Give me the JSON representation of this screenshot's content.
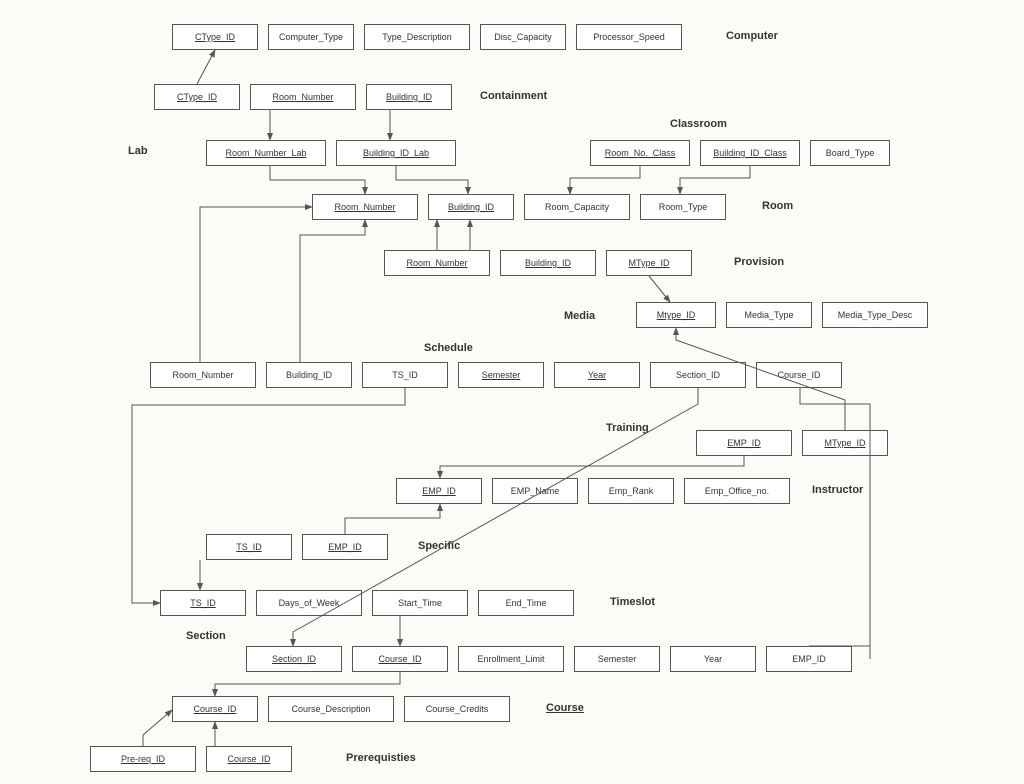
{
  "tables": {
    "computer": {
      "label": "Computer",
      "fields": [
        "CType_ID",
        "Computer_Type",
        "Type_Description",
        "Disc_Capacity",
        "Processor_Speed"
      ],
      "keys": [
        true,
        false,
        false,
        false,
        false
      ]
    },
    "containment": {
      "label": "Containment",
      "fields": [
        "CType_ID",
        "Room_Number",
        "Building_ID"
      ],
      "keys": [
        true,
        true,
        true
      ]
    },
    "lab": {
      "label": "Lab",
      "fields": [
        "Room_Number_Lab",
        "Building_ID_Lab"
      ],
      "keys": [
        true,
        true
      ]
    },
    "classroom": {
      "label": "Classroom",
      "fields": [
        "Room_No._Class",
        "Building_ID_Class",
        "Board_Type"
      ],
      "keys": [
        true,
        true,
        false
      ]
    },
    "room": {
      "label": "Room",
      "fields": [
        "Room_Number",
        "Building_ID",
        "Room_Capacity",
        "Room_Type"
      ],
      "keys": [
        true,
        true,
        false,
        false
      ]
    },
    "provision": {
      "label": "Provision",
      "fields": [
        "Room_Number",
        "Building_ID",
        "MType_ID"
      ],
      "keys": [
        true,
        true,
        true
      ]
    },
    "media": {
      "label": "Media",
      "fields": [
        "Mtype_ID",
        "Media_Type",
        "Media_Type_Desc"
      ],
      "keys": [
        true,
        false,
        false
      ]
    },
    "schedule": {
      "label": "Schedule",
      "fields": [
        "Room_Number",
        "Building_ID",
        "TS_ID",
        "Semester",
        "Year",
        "Section_ID",
        "Course_ID"
      ],
      "keys": [
        false,
        false,
        false,
        true,
        true,
        false,
        false
      ]
    },
    "training": {
      "label": "Training",
      "fields": [
        "EMP_ID",
        "MType_ID"
      ],
      "keys": [
        true,
        true
      ]
    },
    "instructor": {
      "label": "Instructor",
      "fields": [
        "EMP_ID",
        "EMP_Name",
        "Emp_Rank",
        "Emp_Office_no."
      ],
      "keys": [
        true,
        false,
        false,
        false
      ]
    },
    "specific": {
      "label": "Specific",
      "fields": [
        "TS_ID",
        "EMP_ID"
      ],
      "keys": [
        true,
        true
      ]
    },
    "timeslot": {
      "label": "Timeslot",
      "fields": [
        "TS_ID",
        "Days_of_Week",
        "Start_Time",
        "End_Time"
      ],
      "keys": [
        true,
        false,
        false,
        false
      ]
    },
    "section": {
      "label": "Section",
      "fields": [
        "Section_ID",
        "Course_ID",
        "Enrollment_Limit",
        "Semester",
        "Year",
        "EMP_ID"
      ],
      "keys": [
        true,
        true,
        false,
        false,
        false,
        false
      ]
    },
    "course": {
      "label": "Course",
      "fields": [
        "Course_ID",
        "Course_Description",
        "Course_Credits"
      ],
      "keys": [
        true,
        false,
        false
      ]
    },
    "prerequisites": {
      "label": "Prerequisties",
      "fields": [
        "Pre-req_ID",
        "Course_ID"
      ],
      "keys": [
        true,
        true
      ]
    }
  }
}
